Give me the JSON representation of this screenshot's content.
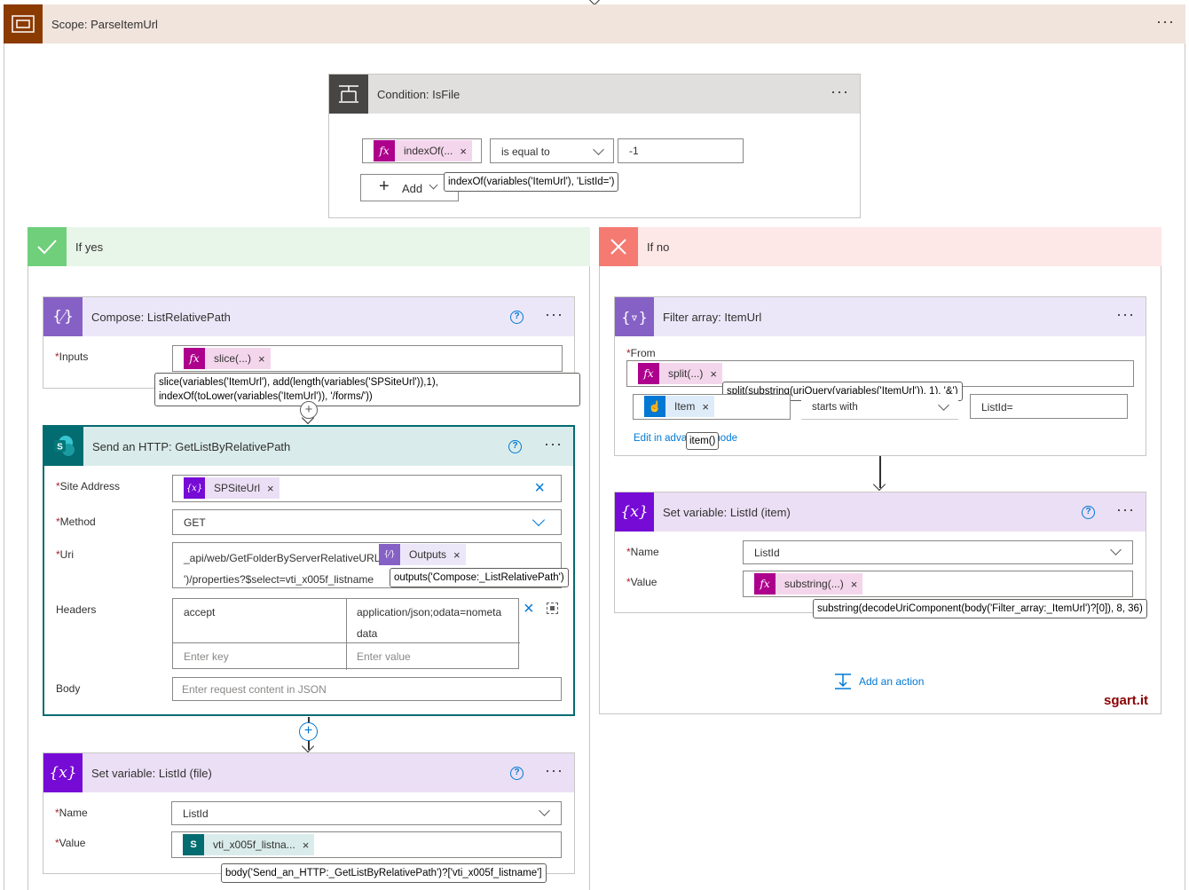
{
  "scope": {
    "title": "Scope: ParseItemUrl",
    "more": "···"
  },
  "condition": {
    "title": "Condition: IsFile",
    "more": "···",
    "left_token": "indexOf(...",
    "operator": "is equal to",
    "value": "-1",
    "add_label": "Add",
    "tooltip": "indexOf(variables('ItemUrl'), 'ListId=')"
  },
  "if_yes": {
    "label": "If yes"
  },
  "if_no": {
    "label": "If no"
  },
  "compose": {
    "title": "Compose: ListRelativePath",
    "help": "?",
    "more": "···",
    "inputs_label": "Inputs",
    "token": "slice(...)",
    "tooltip_line1": "slice(variables('ItemUrl'), add(length(variables('SPSiteUrl')),1),",
    "tooltip_line2": "indexOf(toLower(variables('ItemUrl')), '/forms/'))"
  },
  "http": {
    "title": "Send an HTTP: GetListByRelativePath",
    "help": "?",
    "more": "···",
    "site_label": "Site Address",
    "site_token": "SPSiteUrl",
    "method_label": "Method",
    "method_value": "GET",
    "uri_label": "Uri",
    "uri_text1": "_api/web/GetFolderByServerRelativeURL('",
    "uri_token": "Outputs",
    "uri_text2": "')/properties?$select=vti_x005f_listname",
    "uri_tooltip": "outputs('Compose:_ListRelativePath')",
    "headers_label": "Headers",
    "header_key": "accept",
    "header_value_line1": "application/json;odata=nometa",
    "header_value_line2": "data",
    "key_placeholder": "Enter key",
    "value_placeholder": "Enter value",
    "body_label": "Body",
    "body_placeholder": "Enter request content in JSON"
  },
  "setvar_file": {
    "title": "Set variable: ListId (file)",
    "help": "?",
    "more": "···",
    "name_label": "Name",
    "name_value": "ListId",
    "value_label": "Value",
    "value_token": "vti_x005f_listna...",
    "tooltip": "body('Send_an_HTTP:_GetListByRelativePath')?['vti_x005f_listname']"
  },
  "filter": {
    "title": "Filter array: ItemUrl",
    "more": "···",
    "from_label": "From",
    "from_token": "split(...)",
    "from_tooltip": "split(substring(uriQuery(variables('ItemUrl')), 1), '&')",
    "item_token": "Item",
    "item_tooltip": "item()",
    "operator": "starts with",
    "value": "ListId=",
    "advanced_link": "Edit in advanced mode"
  },
  "setvar_item": {
    "title": "Set variable: ListId (item)",
    "help": "?",
    "more": "···",
    "name_label": "Name",
    "name_value": "ListId",
    "value_label": "Value",
    "value_token": "substring(...)",
    "tooltip": "substring(decodeUriComponent(body('Filter_array:_ItemUrl')?[0]), 8, 36)"
  },
  "add_action": {
    "label": "Add an action"
  },
  "watermark": "sgart.it",
  "required_marker": "*",
  "colors": {
    "scope_dark": "#8b3a00",
    "scope_header": "#f0e4dd",
    "condition_icon": "#484644",
    "yes_green": "#6fcf7b",
    "yes_header": "#e8f5e9",
    "no_red": "#f47a72",
    "no_header": "#fde7e7",
    "compose_purple": "#8661c5",
    "compose_header": "#ece7f8",
    "var_purple": "#770bd6",
    "var_header": "#ebdff5",
    "sharepoint_teal": "#036c70",
    "http_header": "#d9eceb",
    "expr_magenta": "#ad008c",
    "token_pink": "#f4d6ec",
    "link_blue": "#0078d4",
    "watermark_red": "#8b0000"
  }
}
